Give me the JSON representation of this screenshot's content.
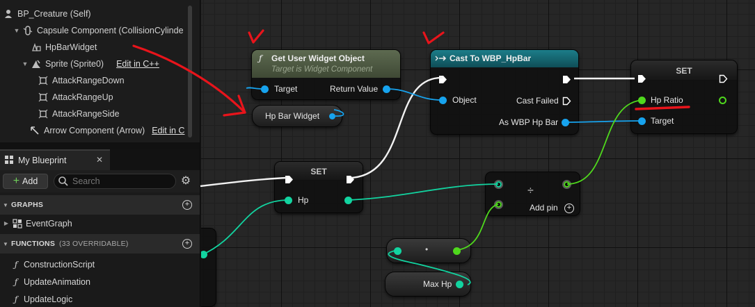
{
  "components": {
    "root": "BP_Creature (Self)",
    "capsule": "Capsule Component (CollisionCylinde",
    "hp_widget": "HpBarWidget",
    "sprite": "Sprite (Sprite0)",
    "sprite_edit": "Edit in C++",
    "range_down": "AttackRangeDown",
    "range_up": "AttackRangeUp",
    "range_side": "AttackRangeSide",
    "arrow": "Arrow Component (Arrow)",
    "arrow_edit": "Edit in C"
  },
  "my_blueprint": {
    "tab_label": "My Blueprint",
    "add_label": "Add",
    "search_placeholder": "Search",
    "graphs_header": "GRAPHS",
    "event_graph": "EventGraph",
    "functions_header": "FUNCTIONS",
    "functions_sub": "(33 OVERRIDABLE)",
    "functions": [
      "ConstructionScript",
      "UpdateAnimation",
      "UpdateLogic"
    ]
  },
  "graph": {
    "get_widget": {
      "title": "Get User Widget Object",
      "subtitle": "Target is Widget Component",
      "target": "Target",
      "return_value": "Return Value"
    },
    "hp_bar_widget": {
      "label": "Hp Bar Widget"
    },
    "cast": {
      "title": "Cast To WBP_HpBar",
      "object": "Object",
      "cast_failed": "Cast Failed",
      "as_wbp": "As WBP Hp Bar"
    },
    "set_ratio": {
      "title": "SET",
      "hp_ratio": "Hp Ratio",
      "target": "Target"
    },
    "set_hp": {
      "title": "SET",
      "hp": "Hp"
    },
    "divide": {
      "symbol": "÷",
      "add_pin": "Add pin"
    },
    "reroute": {
      "dot": "•"
    },
    "max_hp": {
      "label": "Max Hp"
    }
  },
  "colors": {
    "annotation_red": "#e8141b",
    "float_pin": "#4fd81d",
    "object_pin": "#17a3ee",
    "int_pin": "#12d4a0",
    "cast_header": "#14636e",
    "function_header": "#4f5c45"
  }
}
